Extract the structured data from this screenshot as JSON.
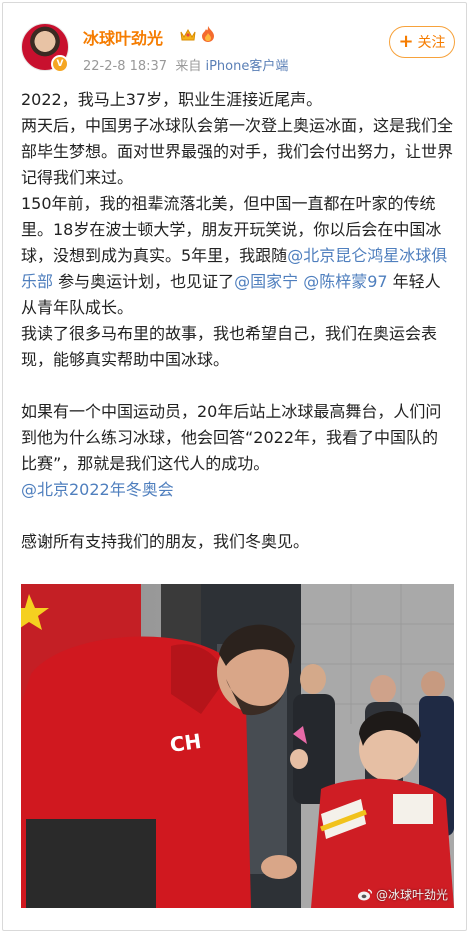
{
  "user": {
    "name": "冰球叶劲光",
    "badges": [
      "crown-icon",
      "fire-icon"
    ]
  },
  "post_meta": {
    "date": "22-2-8 18:37",
    "source_prefix": "来自",
    "client": "iPhone客户端"
  },
  "follow_label": "关注",
  "post": {
    "p1": "2022，我马上37岁，职业生涯接近尾声。",
    "p2": "两天后，中国男子冰球队会第一次登上奥运冰面，这是我们全部毕生梦想。面对世界最强的对手，我们会付出努力，让世界记得我们来过。",
    "p3a": "150年前，我的祖辈流落北美，但中国一直都在叶家的传统里。18岁在波士顿大学，朋友开玩笑说，你以后会在中国冰球，没想到成为真实。5年里，我跟随",
    "m1": "@北京昆仑鸿星冰球俱乐部",
    "p3b": " 参与奥运计划，也见证了",
    "m2": "@国家宁",
    "p3c": " ",
    "m3": "@陈梓蒙97",
    "p3d": " 年轻人从青年队成长。",
    "p4": "我读了很多马布里的故事，我也希望自己，我们在奥运会表现，能够真实帮助中国冰球。",
    "p5": "如果有一个中国运动员，20年后站上冰球最高舞台，人们问到他为什么练习冰球，他会回答“2022年，我看了中国队的比赛”，那就是我们这代人的成功。",
    "m4": "@北京2022年冬奥会",
    "p6": "感谢所有支持我们的朋友，我们冬奥见。"
  },
  "photo": {
    "watermark": "@冰球叶劲光",
    "icon": "weibo-icon"
  },
  "colors": {
    "username": "#f57c00",
    "mention": "#4f7fbe",
    "meta": "#999999",
    "jersey_red": "#c8102e"
  }
}
